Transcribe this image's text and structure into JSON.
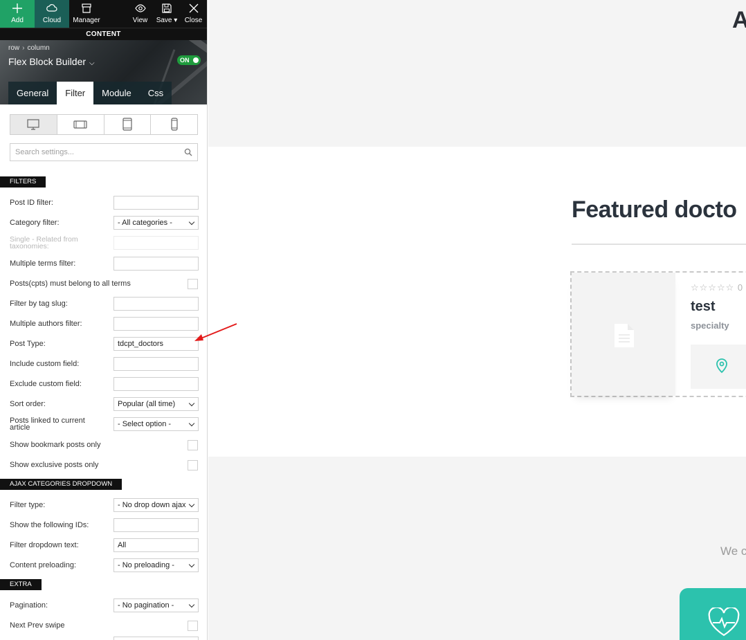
{
  "toolbar": {
    "add": "Add",
    "cloud": "Cloud",
    "manager": "Manager",
    "view": "View",
    "save": "Save",
    "close": "Close"
  },
  "content_title": "CONTENT",
  "breadcrumb": {
    "row": "row",
    "column": "column"
  },
  "builder_title": "Flex Block Builder",
  "toggle_label": "ON",
  "tabs": [
    "General",
    "Filter",
    "Module",
    "Css"
  ],
  "active_tab": "Filter",
  "devices": [
    "desktop-icon",
    "tablet-landscape-icon",
    "tablet-portrait-icon",
    "phone-icon"
  ],
  "search": {
    "placeholder": "Search settings..."
  },
  "sections": {
    "filters": "FILTERS",
    "ajax": "AJAX CATEGORIES DROPDOWN",
    "extra": "EXTRA"
  },
  "filters": {
    "post_id": {
      "label": "Post ID filter:",
      "value": ""
    },
    "category": {
      "label": "Category filter:",
      "value": "- All categories -"
    },
    "single_related": {
      "label": "Single - Related from taxonomies:",
      "value": ""
    },
    "multiple_terms": {
      "label": "Multiple terms filter:",
      "value": ""
    },
    "must_belong": {
      "label": "Posts(cpts) must belong to all terms"
    },
    "tag_slug": {
      "label": "Filter by tag slug:",
      "value": ""
    },
    "authors": {
      "label": "Multiple authors filter:",
      "value": ""
    },
    "post_type": {
      "label": "Post Type:",
      "value": "tdcpt_doctors"
    },
    "include_cf": {
      "label": "Include custom field:",
      "value": ""
    },
    "exclude_cf": {
      "label": "Exclude custom field:",
      "value": ""
    },
    "sort_order": {
      "label": "Sort order:",
      "value": "Popular (all time)"
    },
    "linked": {
      "label": "Posts linked to current article",
      "value": "- Select option -"
    },
    "bookmark": {
      "label": "Show bookmark posts only"
    },
    "exclusive": {
      "label": "Show exclusive posts only"
    }
  },
  "ajax": {
    "filter_type": {
      "label": "Filter type:",
      "value": "- No drop down ajax filter -"
    },
    "ids": {
      "label": "Show the following IDs:",
      "value": ""
    },
    "dropdown_text": {
      "label": "Filter dropdown text:",
      "value": "All"
    },
    "preloading": {
      "label": "Content preloading:",
      "value": "- No preloading -"
    }
  },
  "extra": {
    "pagination": {
      "label": "Pagination:",
      "value": "- No pagination -"
    },
    "swipe": {
      "label": "Next Prev swipe"
    }
  },
  "preview": {
    "header_letter": "A",
    "section_title": "Featured docto",
    "card": {
      "rating_text": "0",
      "name": "test",
      "specialty": "specialty"
    },
    "cta_text": "We c"
  },
  "colors": {
    "accent_green": "#20a266",
    "teal": "#2cc2ad",
    "arrow": "#e31b1b"
  }
}
